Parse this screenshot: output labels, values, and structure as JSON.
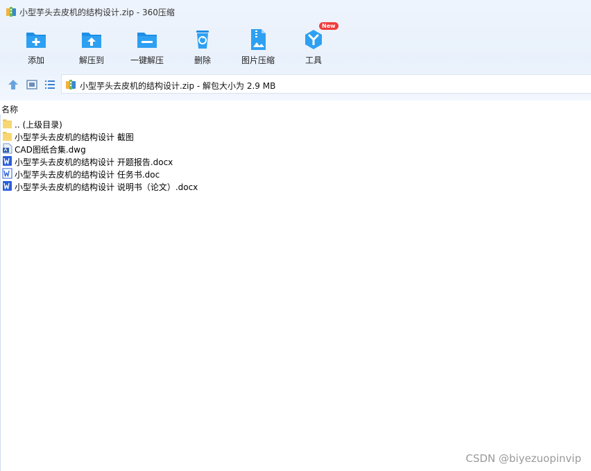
{
  "window": {
    "title": "小型芋头去皮机的结构设计.zip - 360压缩"
  },
  "toolbar": {
    "add_label": "添加",
    "extract_to_label": "解压到",
    "one_click_extract_label": "一键解压",
    "delete_label": "删除",
    "image_compress_label": "图片压缩",
    "tools_label": "工具",
    "tools_badge": "New"
  },
  "navbar": {
    "address_text": "小型芋头去皮机的结构设计.zip - 解包大小为 2.9 MB"
  },
  "list": {
    "header_name": "名称",
    "items": [
      {
        "name": ".. (上级目录)",
        "icon": "folder-icon"
      },
      {
        "name": "小型芋头去皮机的结构设计 截图",
        "icon": "folder-icon"
      },
      {
        "name": "CAD图纸合集.dwg",
        "icon": "dwg-file-icon"
      },
      {
        "name": "小型芋头去皮机的结构设计 开题报告.docx",
        "icon": "word-docx-icon"
      },
      {
        "name": "小型芋头去皮机的结构设计 任务书.doc",
        "icon": "word-doc-icon"
      },
      {
        "name": "小型芋头去皮机的结构设计 说明书（论文）.docx",
        "icon": "word-docx-icon"
      }
    ]
  },
  "watermark": "CSDN @biyezuopinvip",
  "colors": {
    "accent_blue": "#1e8ee6",
    "word_blue": "#2b5fd9",
    "folder_yellow": "#f7d774",
    "badge_red": "#f03c3c"
  }
}
